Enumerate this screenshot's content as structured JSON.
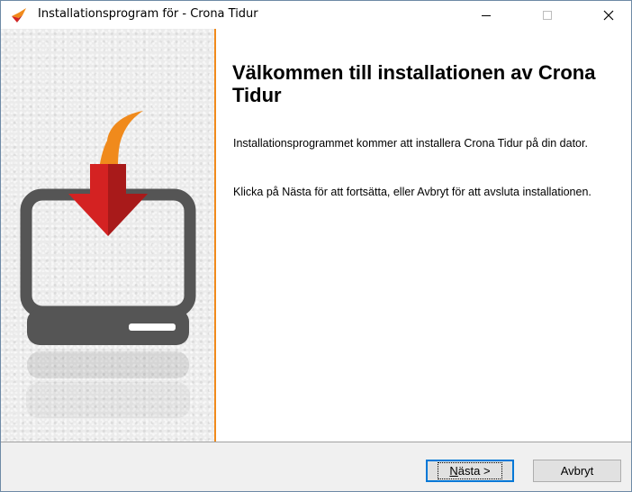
{
  "window": {
    "title": "Installationsprogram för - Crona Tidur",
    "controls": [
      "minimize",
      "maximize",
      "close"
    ]
  },
  "main": {
    "heading": "Välkommen till installationen av Crona Tidur",
    "paragraph_1": "Installationsprogrammet kommer att installera Crona Tidur på din dator.",
    "paragraph_2": "Klicka på Nästa för att fortsätta, eller Avbryt för att avsluta installationen."
  },
  "buttons": {
    "next_mnemonic": "N",
    "next_rest": "ästa >",
    "cancel_label": "Avbryt"
  },
  "colors": {
    "accent_line": "#f08a1c",
    "arrow_red": "#d42222",
    "arrow_orange": "#f08a1c",
    "monitor_gray": "#555555",
    "focus_blue": "#0078d7"
  },
  "icons": {
    "app_icon": "installer-icon",
    "illustration": "computer-download-illustration"
  }
}
